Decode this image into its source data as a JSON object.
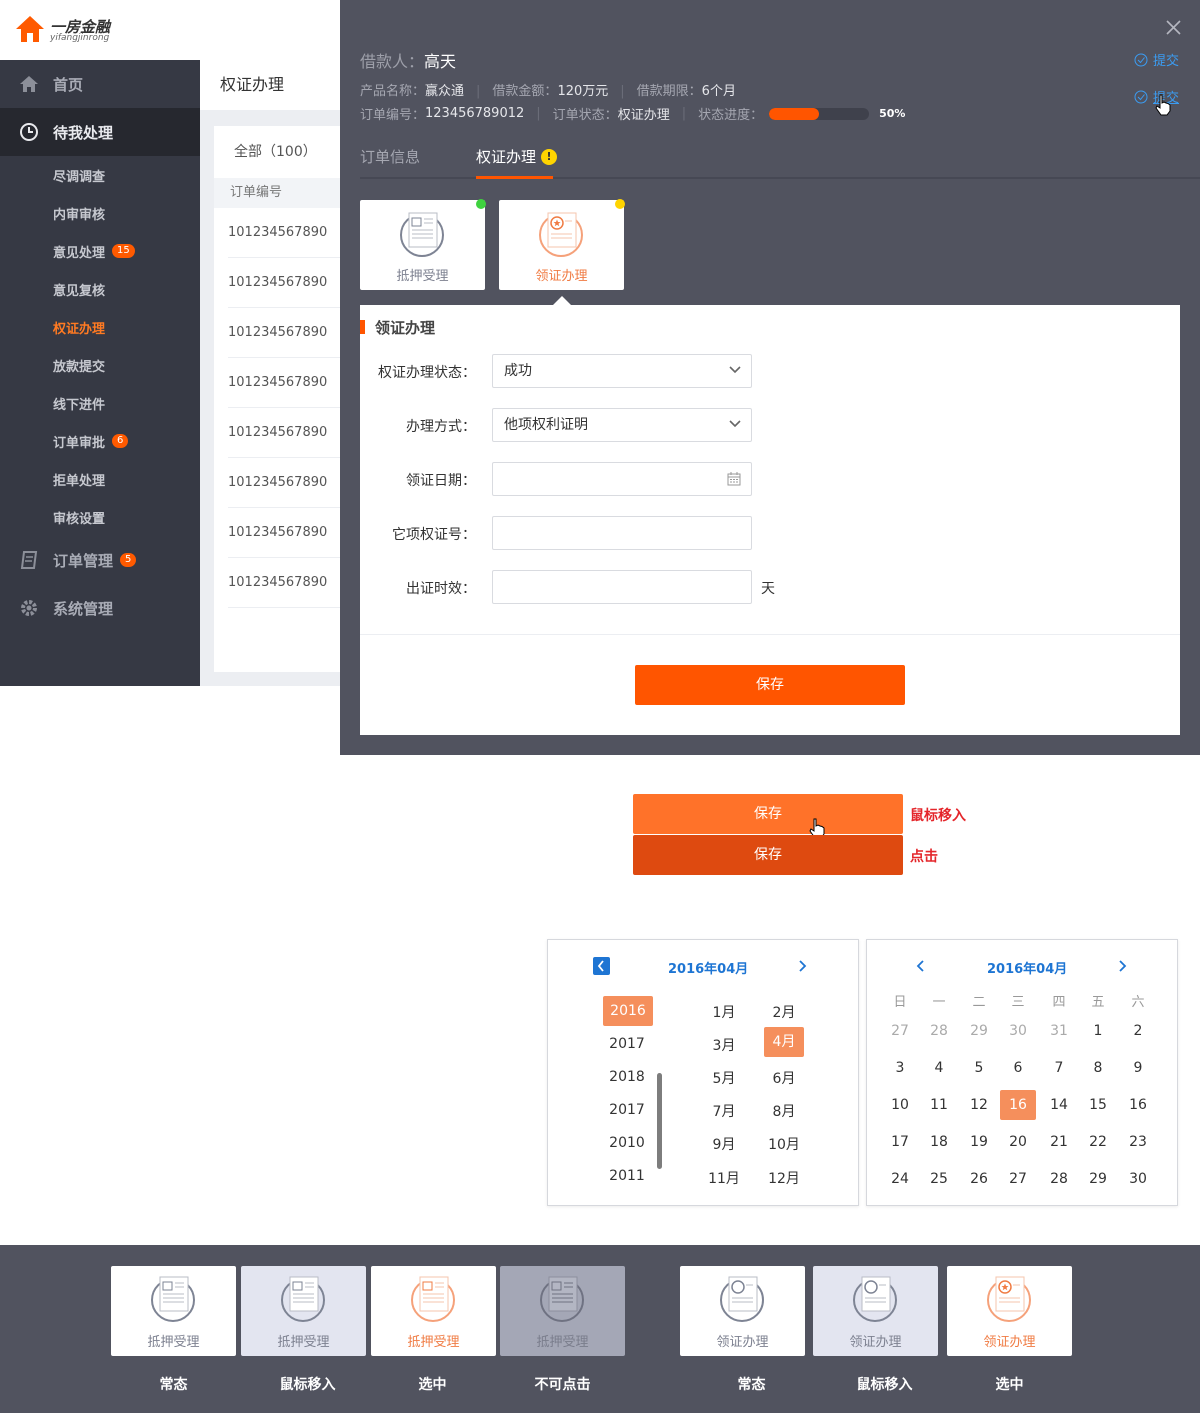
{
  "app": {
    "logo_cn": "一房金融",
    "logo_en": "yifangjinrong"
  },
  "sidebar": {
    "items": [
      {
        "label": "首页",
        "icon": "home-icon",
        "active": false
      },
      {
        "label": "待我处理",
        "icon": "clock-icon",
        "active": true
      }
    ],
    "sub_items": [
      {
        "label": "尽调调查",
        "badge": ""
      },
      {
        "label": "内审审核",
        "badge": ""
      },
      {
        "label": "意见处理",
        "badge": "15"
      },
      {
        "label": "意见复核",
        "badge": ""
      },
      {
        "label": "权证办理",
        "badge": "",
        "active": true
      },
      {
        "label": "放款提交",
        "badge": ""
      },
      {
        "label": "线下进件",
        "badge": ""
      },
      {
        "label": "订单审批",
        "badge": "6"
      },
      {
        "label": "拒单处理",
        "badge": ""
      },
      {
        "label": "审核设置",
        "badge": ""
      }
    ],
    "bottom_items": [
      {
        "label": "订单管理",
        "icon": "document-icon",
        "badge": "5"
      },
      {
        "label": "系统管理",
        "icon": "gear-icon",
        "badge": ""
      }
    ]
  },
  "page": {
    "title": "权证办理"
  },
  "list": {
    "tab_label": "全部（100）",
    "column_header": "订单编号",
    "rows": [
      "101234567890",
      "101234567890",
      "101234567890",
      "101234567890",
      "101234567890",
      "101234567890",
      "101234567890",
      "101234567890"
    ]
  },
  "drawer": {
    "borrower_label": "借款人：",
    "borrower_name": "高天",
    "product_label": "产品名称：",
    "product_value": "赢众通",
    "amount_label": "借款金额：",
    "amount_value": "120万元",
    "term_label": "借款期限：",
    "term_value": "6个月",
    "order_no_label": "订单编号：",
    "order_no_value": "123456789012",
    "status_label": "订单状态：",
    "status_value": "权证办理",
    "progress_label": "状态进度：",
    "progress_text": "50%",
    "progress_value": 0.5,
    "submit_label": "提交",
    "submit_hover_label": "提交",
    "tabs": [
      {
        "label": "订单信息"
      },
      {
        "label": "权证办理"
      }
    ],
    "step_cards": [
      {
        "label": "抵押受理"
      },
      {
        "label": "领证办理"
      }
    ],
    "form": {
      "section_title": "领证办理",
      "fields": [
        {
          "label": "权证办理状态：",
          "value": "成功"
        },
        {
          "label": "办理方式：",
          "value": "他项权利证明"
        },
        {
          "label": "领证日期：",
          "value": ""
        },
        {
          "label": "它项权证号：",
          "value": ""
        },
        {
          "label": "出证时效：",
          "value": "",
          "suffix": "天"
        }
      ],
      "save_label": "保存"
    }
  },
  "button_states": [
    {
      "label": "保存",
      "note": "鼠标移入"
    },
    {
      "label": "保存",
      "note": "点击"
    }
  ],
  "year_month_picker": {
    "title": "2016年04月",
    "years": [
      "2016",
      "2017",
      "2018",
      "2017",
      "2010",
      "2011"
    ],
    "selected_year": "2016",
    "months": [
      "1月",
      "2月",
      "3月",
      "4月",
      "5月",
      "6月",
      "7月",
      "8月",
      "9月",
      "10月",
      "11月",
      "12月"
    ],
    "selected_month": "4月"
  },
  "day_picker": {
    "title": "2016年04月",
    "weekdays": [
      "日",
      "一",
      "二",
      "三",
      "四",
      "五",
      "六"
    ],
    "rows": [
      [
        "27",
        "28",
        "29",
        "30",
        "31",
        "1",
        "2"
      ],
      [
        "3",
        "4",
        "5",
        "6",
        "7",
        "8",
        "9"
      ],
      [
        "10",
        "11",
        "12",
        "16",
        "14",
        "15",
        "16"
      ],
      [
        "17",
        "18",
        "19",
        "20",
        "21",
        "22",
        "23"
      ],
      [
        "24",
        "25",
        "26",
        "27",
        "28",
        "29",
        "30"
      ]
    ],
    "selected_day": "16"
  },
  "card_states": [
    {
      "label": "抵押受理",
      "state": "常态"
    },
    {
      "label": "抵押受理",
      "state": "鼠标移入"
    },
    {
      "label": "抵押受理",
      "state": "选中"
    },
    {
      "label": "抵押受理",
      "state": "不可点击"
    },
    {
      "label": "领证办理",
      "state": "常态"
    },
    {
      "label": "领证办理",
      "state": "鼠标移入"
    },
    {
      "label": "领证办理",
      "state": "选中"
    }
  ],
  "colors": {
    "accent": "#ff5500",
    "sidebar_bg": "#363944",
    "drawer_bg": "#51535f",
    "link_blue": "#1e75d3",
    "success_dot": "#3fd23f",
    "warn_dot": "#ffd400"
  }
}
